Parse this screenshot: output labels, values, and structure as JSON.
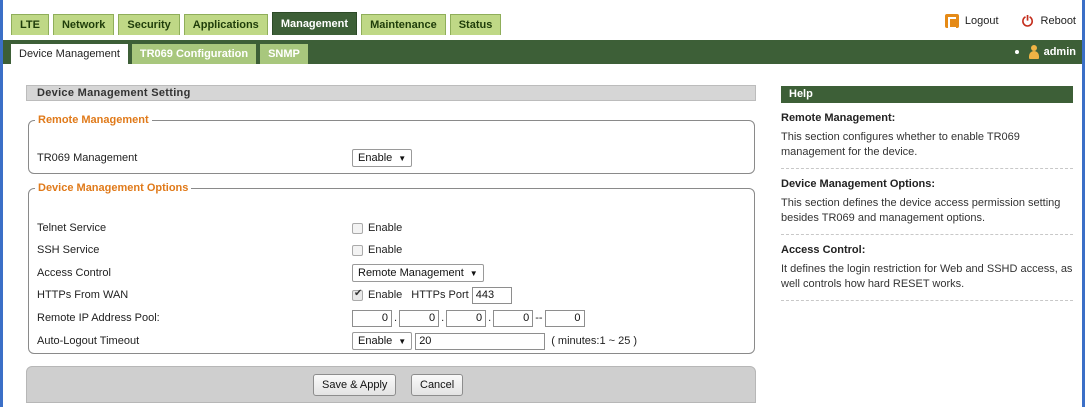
{
  "topbar": {
    "tabs": [
      "LTE",
      "Network",
      "Security",
      "Applications",
      "Management",
      "Maintenance",
      "Status"
    ],
    "active_tab": "Management",
    "logout_label": "Logout",
    "reboot_label": "Reboot"
  },
  "subnav": {
    "tabs": [
      "Device Management",
      "TR069 Configuration",
      "SNMP"
    ],
    "active_tab": "Device Management",
    "username": "admin"
  },
  "main": {
    "section_title": "Device Management Setting",
    "remote_management": {
      "legend": "Remote Management",
      "tr069_label": "TR069 Management",
      "tr069_value": "Enable"
    },
    "options": {
      "legend": "Device Management Options",
      "telnet_label": "Telnet Service",
      "telnet_enable_label": "Enable",
      "telnet_checked": false,
      "ssh_label": "SSH Service",
      "ssh_enable_label": "Enable",
      "ssh_checked": false,
      "access_label": "Access Control",
      "access_value": "Remote Management",
      "https_label": "HTTPs From WAN",
      "https_enable_label": "Enable",
      "https_checked": true,
      "https_port_label": "HTTPs Port",
      "https_port_value": "443",
      "ip_pool_label": "Remote IP Address Pool:",
      "ip_pool_values": [
        "0",
        "0",
        "0",
        "0",
        "0"
      ],
      "ip_sep_dot": ".",
      "ip_sep_range": "--",
      "autologout_label": "Auto-Logout Timeout",
      "autologout_select": "Enable",
      "autologout_value": "20",
      "autologout_hint": "( minutes:1 ~ 25 )"
    },
    "save_label": "Save & Apply",
    "cancel_label": "Cancel"
  },
  "help": {
    "title": "Help",
    "sections": [
      {
        "title": "Remote Management:",
        "text": "This section configures whether to enable TR069 management for the device."
      },
      {
        "title": "Device Management Options:",
        "text": "This section defines the device access permission setting besides TR069 and management options."
      },
      {
        "title": "Access Control:",
        "text": "It defines the login restriction for Web and SSHD access, as well controls how hard RESET works."
      }
    ]
  },
  "colors": {
    "accent_green": "#3d5f37",
    "tab_green": "#bfd886",
    "legend_orange": "#e07a1a",
    "frame_blue": "#3b6fc7"
  }
}
